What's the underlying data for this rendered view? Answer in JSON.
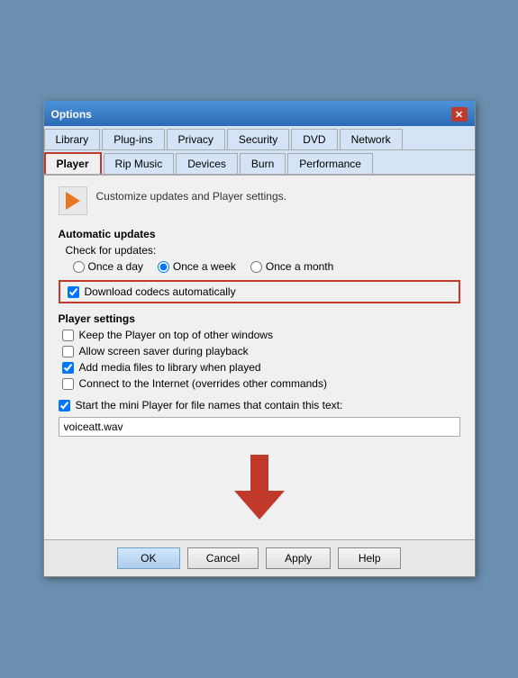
{
  "dialog": {
    "title": "Options"
  },
  "tabs_row1": [
    {
      "id": "library",
      "label": "Library",
      "active": false
    },
    {
      "id": "plugins",
      "label": "Plug-ins",
      "active": false
    },
    {
      "id": "privacy",
      "label": "Privacy",
      "active": false
    },
    {
      "id": "security",
      "label": "Security",
      "active": false
    },
    {
      "id": "dvd",
      "label": "DVD",
      "active": false
    },
    {
      "id": "network",
      "label": "Network",
      "active": false
    }
  ],
  "tabs_row2": [
    {
      "id": "player",
      "label": "Player",
      "active": true
    },
    {
      "id": "rip-music",
      "label": "Rip Music",
      "active": false
    },
    {
      "id": "devices",
      "label": "Devices",
      "active": false
    },
    {
      "id": "burn",
      "label": "Burn",
      "active": false
    },
    {
      "id": "performance",
      "label": "Performance",
      "active": false
    }
  ],
  "header": {
    "description": "Customize updates and Player settings."
  },
  "automatic_updates": {
    "title": "Automatic updates",
    "check_label": "Check for updates:",
    "options": [
      {
        "id": "once-a-day",
        "label": "Once a day",
        "checked": false
      },
      {
        "id": "once-a-week",
        "label": "Once a week",
        "checked": true
      },
      {
        "id": "once-a-month",
        "label": "Once a month",
        "checked": false
      }
    ],
    "download_codecs": {
      "label": "Download codecs automatically",
      "checked": true
    }
  },
  "player_settings": {
    "title": "Player settings",
    "checkboxes": [
      {
        "id": "keep-on-top",
        "label": "Keep the Player on top of other windows",
        "checked": false
      },
      {
        "id": "allow-screensaver",
        "label": "Allow screen saver during playback",
        "checked": false
      },
      {
        "id": "add-media",
        "label": "Add media files to library when played",
        "checked": true
      },
      {
        "id": "connect-internet",
        "label": "Connect to the Internet (overrides other commands)",
        "checked": false
      }
    ]
  },
  "mini_player": {
    "label": "Start the mini Player for file names that contain this text:",
    "checked": true,
    "input_value": "voiceatt.wav",
    "input_placeholder": ""
  },
  "buttons": {
    "ok": "OK",
    "cancel": "Cancel",
    "apply": "Apply",
    "help": "Help"
  },
  "icons": {
    "close": "✕",
    "play": "▶"
  }
}
